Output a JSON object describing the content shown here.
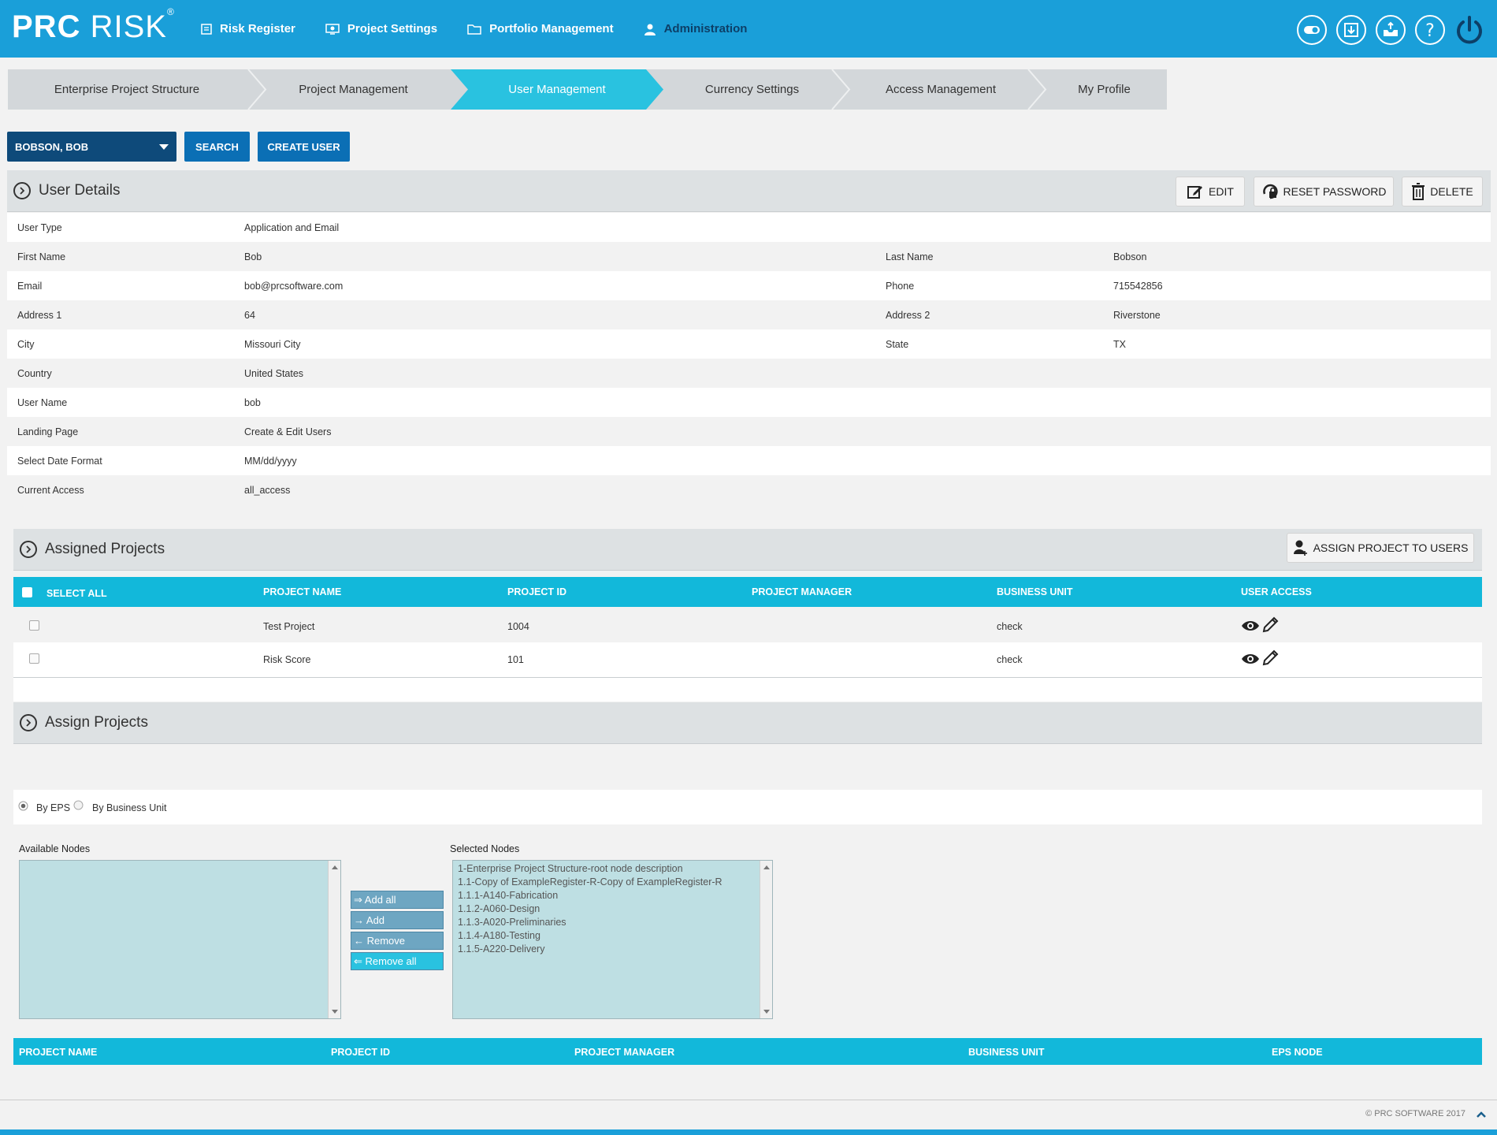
{
  "header": {
    "logo_bold": "PRC",
    "logo_light": " RISK",
    "logo_reg": "®",
    "nav": [
      {
        "label": "Risk Register",
        "icon": "list-icon"
      },
      {
        "label": "Project Settings",
        "icon": "monitor-settings-icon"
      },
      {
        "label": "Portfolio Management",
        "icon": "folder-icon"
      },
      {
        "label": "Administration",
        "icon": "user-icon"
      }
    ],
    "icons": [
      "toggle-icon",
      "download-box-icon",
      "inbox-upload-icon",
      "help-icon",
      "power-icon"
    ]
  },
  "tabs": [
    "Enterprise Project Structure",
    "Project Management",
    "User Management",
    "Currency Settings",
    "Access Management",
    "My Profile"
  ],
  "toolbar": {
    "user_selected": "BOBSON, BOB",
    "search_label": "SEARCH",
    "create_label": "CREATE USER"
  },
  "user_details": {
    "title": "User Details",
    "edit_label": "EDIT",
    "reset_label": "RESET PASSWORD",
    "delete_label": "DELETE",
    "rows": [
      {
        "l1": "User Type",
        "v1": "Application and Email",
        "l2": "",
        "v2": ""
      },
      {
        "l1": "First Name",
        "v1": "Bob",
        "l2": "Last Name",
        "v2": "Bobson"
      },
      {
        "l1": "Email",
        "v1": "bob@prcsoftware.com",
        "l2": "Phone",
        "v2": "715542856"
      },
      {
        "l1": "Address 1",
        "v1": "64",
        "l2": "Address 2",
        "v2": "Riverstone"
      },
      {
        "l1": "City",
        "v1": "Missouri City",
        "l2": "State",
        "v2": "TX"
      },
      {
        "l1": "Country",
        "v1": "United States",
        "l2": "",
        "v2": ""
      },
      {
        "l1": "User Name",
        "v1": "bob",
        "l2": "",
        "v2": ""
      },
      {
        "l1": "Landing Page",
        "v1": "Create & Edit Users",
        "l2": "",
        "v2": ""
      },
      {
        "l1": "Select Date Format",
        "v1": "MM/dd/yyyy",
        "l2": "",
        "v2": ""
      },
      {
        "l1": "Current Access",
        "v1": "all_access",
        "l2": "",
        "v2": ""
      }
    ]
  },
  "assigned_projects": {
    "title": "Assigned Projects",
    "assign_label": "ASSIGN PROJECT TO USERS",
    "columns": [
      "SELECT ALL",
      "PROJECT NAME",
      "PROJECT ID",
      "PROJECT MANAGER",
      "BUSINESS UNIT",
      "USER ACCESS"
    ],
    "rows": [
      {
        "name": "Test Project",
        "id": "1004",
        "manager": "",
        "unit": "check"
      },
      {
        "name": "Risk Score",
        "id": "101",
        "manager": "",
        "unit": "check"
      }
    ]
  },
  "assign_projects": {
    "title": "Assign Projects",
    "radio_eps": "By EPS",
    "radio_bu": "By Business Unit",
    "available_label": "Available Nodes",
    "selected_label": "Selected Nodes",
    "buttons": [
      "⇒ Add all",
      "→ Add",
      "← Remove",
      "⇐ Remove all"
    ],
    "selected_nodes": [
      "1-Enterprise Project Structure-root node description",
      "1.1-Copy of ExampleRegister-R-Copy of ExampleRegister-R",
      "1.1.1-A140-Fabrication",
      "1.1.2-A060-Design",
      "1.1.3-A020-Preliminaries",
      "1.1.4-A180-Testing",
      "1.1.5-A220-Delivery"
    ],
    "columns": [
      "PROJECT NAME",
      "PROJECT ID",
      "PROJECT MANAGER",
      "BUSINESS UNIT",
      "EPS NODE"
    ]
  },
  "footer": {
    "copyright": "© PRC SOFTWARE 2017"
  },
  "colors": {
    "header": "#1a9fd9",
    "tab_active": "#29c2e0",
    "table_header": "#12b8da",
    "dark_button": "#0e4a7a"
  }
}
